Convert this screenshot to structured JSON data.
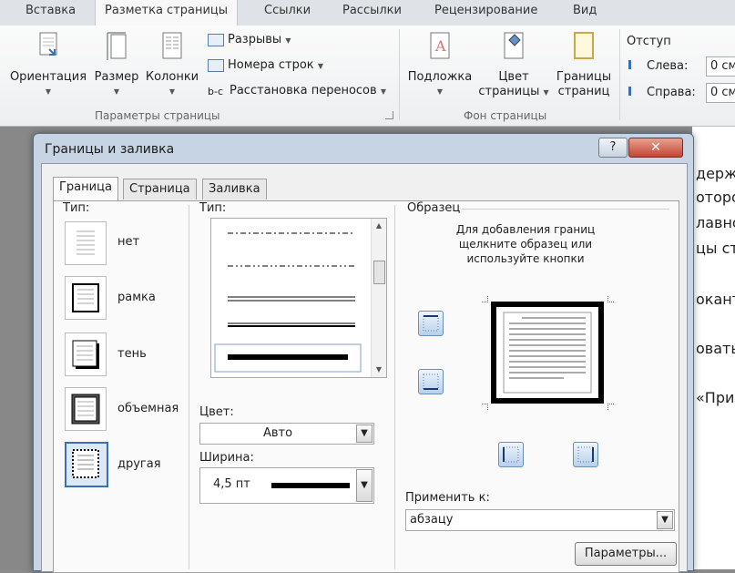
{
  "ribbon": {
    "tabs": [
      "Вставка",
      "Разметка страницы",
      "Ссылки",
      "Рассылки",
      "Рецензирование",
      "Вид"
    ],
    "active_tab": "Разметка страницы",
    "buttons": {
      "orientation": "Ориентация",
      "size": "Размер",
      "columns": "Колонки",
      "breaks": "Разрывы",
      "line_numbers": "Номера строк",
      "hyphenation": "Расстановка переносов",
      "watermark": "Подложка",
      "page_color_1": "Цвет",
      "page_color_2": "страницы",
      "page_borders_1": "Границы",
      "page_borders_2": "страниц"
    },
    "groups": {
      "page_setup": "Параметры страницы",
      "page_background": "Фон страницы"
    },
    "indent": {
      "title": "Отступ",
      "left_label": "Слева:",
      "left_value": "0 см",
      "right_label": "Справа:",
      "right_value": "0 см"
    }
  },
  "document_lines": [
    "держ",
    "оторо",
    "лавно",
    "цы ст",
    "окант",
    "овать",
    "«При"
  ],
  "dialog": {
    "title": "Границы и заливка",
    "help": "?",
    "close": "✕",
    "tabs": [
      "Граница",
      "Страница",
      "Заливка"
    ],
    "type_label": "Тип:",
    "presets": [
      "нет",
      "рамка",
      "тень",
      "объемная",
      "другая"
    ],
    "style_label": "Тип:",
    "color_label": "Цвет:",
    "color_value": "Авто",
    "width_label": "Ширина:",
    "width_value": "4,5 пт",
    "preview_label": "Образец",
    "preview_hint_1": "Для добавления границ",
    "preview_hint_2": "щелкните образец или",
    "preview_hint_3": "используйте кнопки",
    "apply_label": "Применить к:",
    "apply_value": "абзацу",
    "params_button": "Параметры..."
  }
}
